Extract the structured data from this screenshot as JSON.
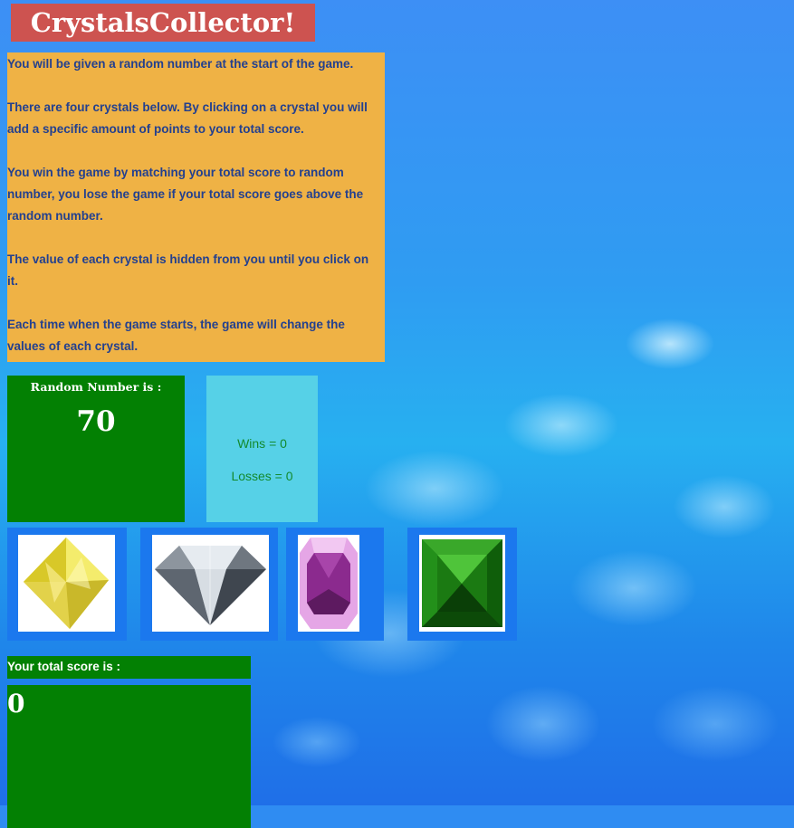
{
  "header": {
    "title": "CrystalsCollector!"
  },
  "instructions": [
    "You will be given a random number at the start of the game.",
    "There are four crystals below. By clicking on a crystal you will add a specific amount of points to your total score.",
    "You win the game by matching your total score to random number, you lose the game if your total score goes above the random number.",
    "The value of each crystal is hidden from you until you click on it.",
    "Each time when the game starts, the game will change the values of each crystal."
  ],
  "random": {
    "label": "Random Number is :",
    "value": "70"
  },
  "stats": {
    "wins": "Wins = 0",
    "losses": "Losses = 0"
  },
  "crystals": [
    {
      "icon": "yellow-crystal-icon",
      "color": "#e8d92a"
    },
    {
      "icon": "diamond-icon",
      "color": "#9aa3ad"
    },
    {
      "icon": "purple-crystal-icon",
      "color": "#8a2a8c"
    },
    {
      "icon": "green-crystal-icon",
      "color": "#1c8a12"
    }
  ],
  "total": {
    "label": "Your total score is :",
    "value": "0"
  },
  "colors": {
    "title_bg": "#cd5350",
    "instructions_bg": "#efb245",
    "instructions_text": "#23408f",
    "panel_green": "#038003",
    "stats_bg": "#56d1e7",
    "crystal_frame": "#1b78ee"
  }
}
